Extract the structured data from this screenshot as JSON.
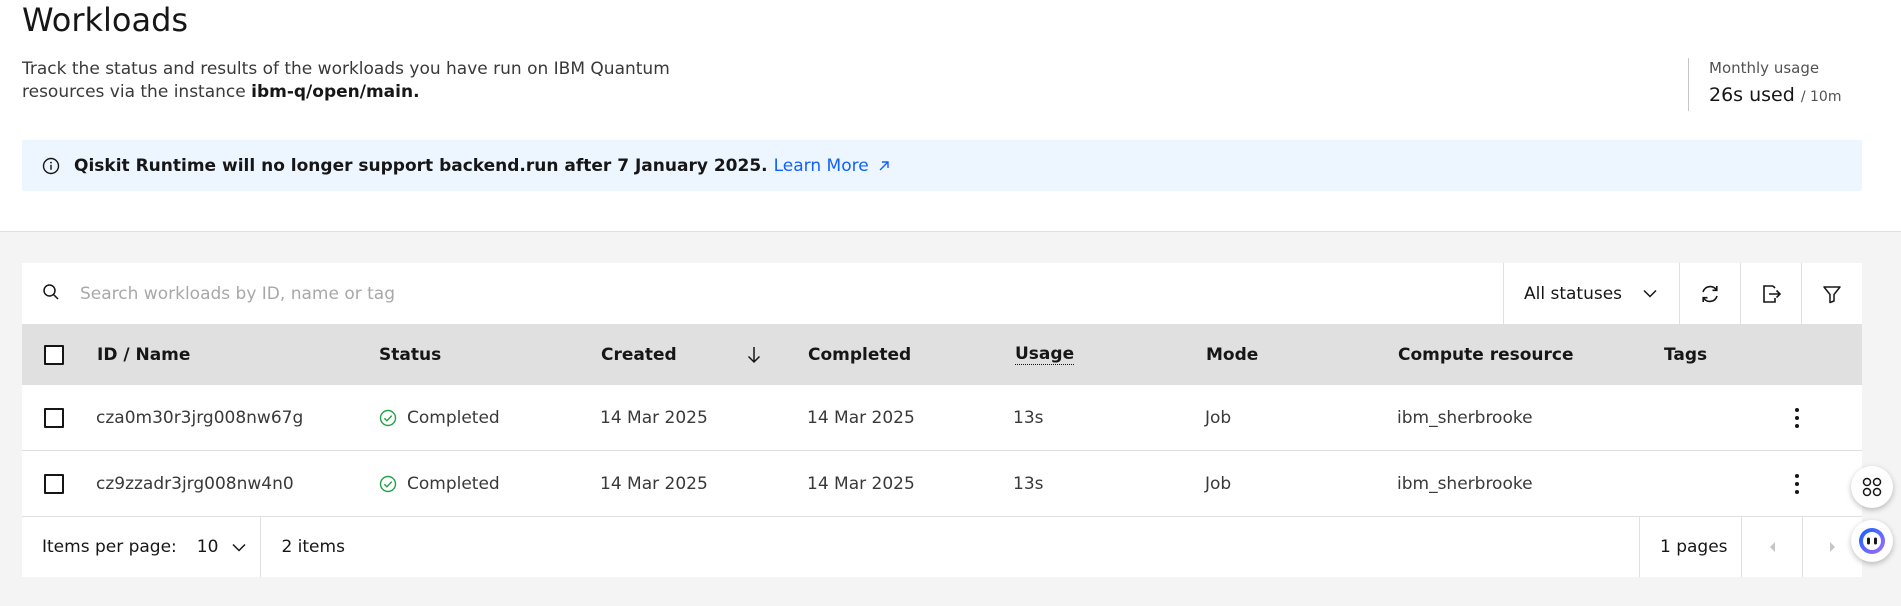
{
  "header": {
    "title": "Workloads",
    "description_pre": "Track the status and results of the workloads you have run on IBM Quantum resources via the instance ",
    "instance": "ibm-q/open/main."
  },
  "usage": {
    "label": "Monthly usage",
    "used": "26s used",
    "limit": "/ 10m"
  },
  "banner": {
    "text": "Qiskit Runtime will no longer support backend.run after 7 January 2025.",
    "link": "Learn More"
  },
  "toolbar": {
    "search_placeholder": "Search workloads by ID, name or tag",
    "status_filter": "All statuses",
    "icons": [
      "search-icon",
      "refresh-icon",
      "export-icon",
      "filter-icon"
    ]
  },
  "table": {
    "columns": {
      "id_name": "ID / Name",
      "status": "Status",
      "created": "Created",
      "completed": "Completed",
      "usage": "Usage",
      "mode": "Mode",
      "compute_resource": "Compute resource",
      "tags": "Tags"
    },
    "rows": [
      {
        "id": "cza0m30r3jrg008nw67g",
        "status": "Completed",
        "created": "14 Mar 2025",
        "completed": "14 Mar 2025",
        "usage": "13s",
        "mode": "Job",
        "compute_resource": "ibm_sherbrooke",
        "tags": ""
      },
      {
        "id": "cz9zzadr3jrg008nw4n0",
        "status": "Completed",
        "created": "14 Mar 2025",
        "completed": "14 Mar 2025",
        "usage": "13s",
        "mode": "Job",
        "compute_resource": "ibm_sherbrooke",
        "tags": ""
      }
    ]
  },
  "pagination": {
    "items_per_page_label": "Items per page:",
    "items_per_page": "10",
    "items_count": "2 items",
    "pages": "1 pages"
  },
  "colors": {
    "link": "#0f62fe",
    "success": "#24a148",
    "banner_bg": "#edf5ff",
    "header_bg": "#e0e0e0"
  }
}
